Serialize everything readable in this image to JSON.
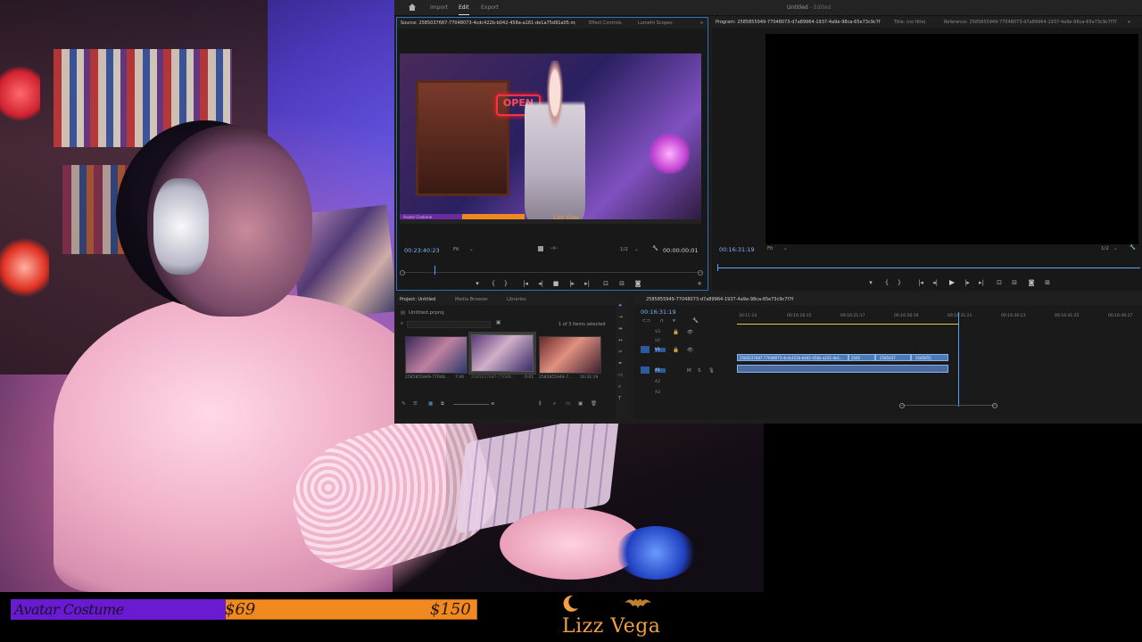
{
  "app": {
    "title": "Untitled",
    "title_suffix": "- Edited",
    "nav": {
      "import": "Import",
      "edit": "Edit",
      "export": "Export"
    }
  },
  "source_panel": {
    "tab_source": "Source: 2585037687-77048073-4cdc422b-b042-458a-a161-de1a75d91a05.mp4",
    "tab_effect_controls": "Effect Controls",
    "tab_lumetri": "Lumetri Scopes",
    "timecode": "00:23:40:23",
    "fit": "Fit",
    "resolution": "1/2",
    "duration": "00:00:00:01",
    "overlay_name": "Lizz Vega",
    "overlay_sign": "OPEN",
    "overlay_label": "Avatar Costume"
  },
  "program_panel": {
    "tab_program": "Program: 2585855949-77048073-d7a89964-1937-4a9e-98ca-65e73c9c7f7f",
    "tab_title": "Title: (no title)",
    "tab_reference": "Reference: 2585855949-77048073-d7a89964-1937-4a9e-98ca-65e73c9c7f7f",
    "timecode": "00:16:31:19",
    "fit": "Fit",
    "resolution": "1/2"
  },
  "project_panel": {
    "tab_project": "Project: Untitled",
    "tab_media_browser": "Media Browser",
    "tab_libraries": "Libraries",
    "project_file": "Untitled.prproj",
    "selection_status": "1 of 3 items selected",
    "items": [
      {
        "name": "2585855949-77048...",
        "duration": "7:40"
      },
      {
        "name": "2585037687-77048...",
        "duration": "0:01"
      },
      {
        "name": "2585855949-7...",
        "duration": "16:31:19"
      }
    ]
  },
  "timeline": {
    "sequence_tab": "2585855949-77048073-d7a89964-1937-4a9e-98ca-65e73c9c7f7f",
    "timecode": "00:16:31:19",
    "ruler": [
      "16:11:14",
      "00:16:16:15",
      "00:16:21:17",
      "00:16:26:19",
      "00:16:31:21",
      "00:16:36:23",
      "00:16:41:25",
      "00:16:46:27"
    ],
    "tracks_video": [
      "V3",
      "V2",
      "V1"
    ],
    "tracks_audio": [
      "A1",
      "A2",
      "A3"
    ],
    "clip_labels": [
      "2585037687-77048073-4cdc422b-b042-458a-a161-de1...",
      "2585",
      "2585037",
      "2585855"
    ]
  },
  "stream_overlay": {
    "goal_label": "Avatar Costume",
    "goal_current": "$69",
    "goal_target": "$150",
    "goal_progress": 0.46,
    "brand": "Lizz Vega"
  },
  "icons": [
    "home-icon",
    "play-icon",
    "step-back-icon",
    "step-forward-icon",
    "mark-in-icon",
    "mark-out-icon",
    "camera-icon",
    "wrench-icon",
    "search-icon",
    "folder-icon",
    "selection-tool-icon",
    "razor-tool-icon",
    "pen-tool-icon",
    "hand-tool-icon",
    "zoom-tool-icon",
    "type-tool-icon"
  ],
  "colors": {
    "accent": "#2d6fc2",
    "timecode": "#7db4f5",
    "goal_fill": "#6a1ad0",
    "goal_bg": "#f08a20",
    "brand": "#f0a040"
  }
}
